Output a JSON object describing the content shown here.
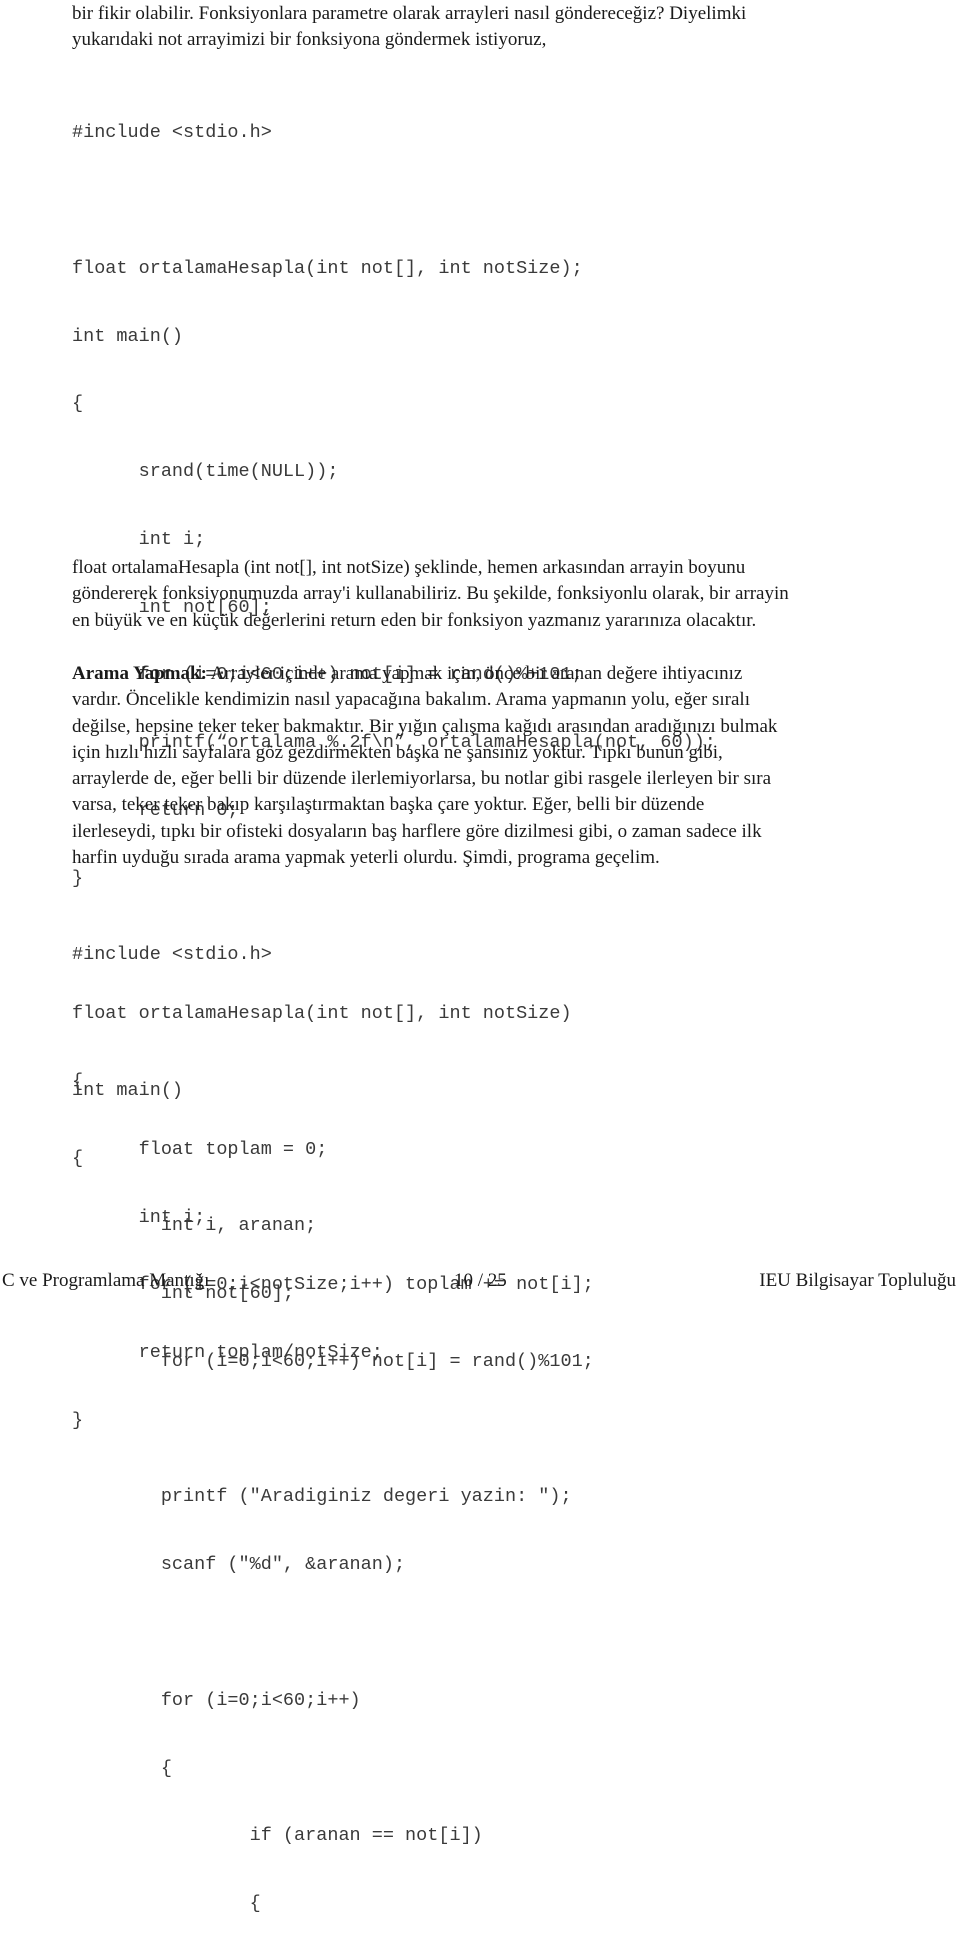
{
  "intro": {
    "lines": [
      "bir fikir olabilir. Fonksiyonlara parametre olarak arrayleri nasıl göndereceğiz? Diyelimki",
      "yukarıdaki not arrayimizi bir fonksiyona göndermek istiyoruz,"
    ]
  },
  "code_block_1": {
    "lines": [
      "#include <stdio.h>",
      "",
      "float ortalamaHesapla(int not[], int notSize);",
      "int main()",
      "{",
      "      srand(time(NULL));",
      "      int i;",
      "      int not[60];",
      "      for (i=0;i<60;i++) not[i] = rand()%+101;",
      "      printf(“ortalama %.2f\\n”, ortalamaHesapla(not, 60));",
      "      return 0;",
      "}",
      "",
      "float ortalamaHesapla(int not[], int notSize)",
      "{",
      "      float toplam = 0;",
      "      int i;",
      "      for (i=0;i<notSize;i++) toplam += not[i];",
      "      return toplam/notSize;",
      "}"
    ]
  },
  "paragraph_2": {
    "lines": [
      "float ortalamaHesapla (int not[], int notSize) şeklinde, hemen arkasından arrayin boyunu",
      "göndererek fonksiyonumuzda array'i kullanabiliriz. Bu şekilde, fonksiyonlu olarak, bir arrayin",
      "en büyük ve en küçük değerlerini return eden bir fonksiyon yazmanız yararınıza olacaktır."
    ]
  },
  "paragraph_3": {
    "heading": "Arama Yapmak:",
    "first_line_rest": " Arrayler içinde arama yapmak için, önce bir aranan değere ihtiyacınız",
    "lines": [
      "vardır. Öncelikle kendimizin nasıl yapacağına bakalım. Arama yapmanın yolu, eğer sıralı",
      "değilse, hepsine teker teker bakmaktır. Bir yığın çalışma kağıdı arasından aradığınızı bulmak",
      "için hızlı hızlı sayfalara göz gezdirmekten başka ne şansınız yoktur. Tıpkı bunun gibi,",
      "arraylerde de, eğer belli bir düzende ilerlemiyorlarsa, bu notlar gibi rasgele ilerleyen bir sıra",
      "varsa, teker teker bakıp karşılaştırmaktan başka çare yoktur. Eğer, belli bir düzende",
      "ilerleseydi, tıpkı bir ofisteki dosyaların baş harflere göre dizilmesi gibi, o zaman sadece ilk",
      "harfin uyduğu sırada arama yapmak yeterli olurdu. Şimdi, programa geçelim."
    ]
  },
  "code_block_2": {
    "lines": [
      "#include <stdio.h>",
      "",
      "int main()",
      "{",
      "        int i, aranan;",
      "        int not[60];",
      "        for (i=0;i<60;i++) not[i] = rand()%101;",
      "",
      "        printf (\"Aradiginiz degeri yazin: \");",
      "        scanf (\"%d\", &aranan);",
      "",
      "        for (i=0;i<60;i++)",
      "        {",
      "                if (aranan == not[i])",
      "                {"
    ]
  },
  "footer": {
    "left": "C ve Programlama Mantığı",
    "center": "10 / 25",
    "right": "IEU Bilgisayar Topluluğu"
  }
}
